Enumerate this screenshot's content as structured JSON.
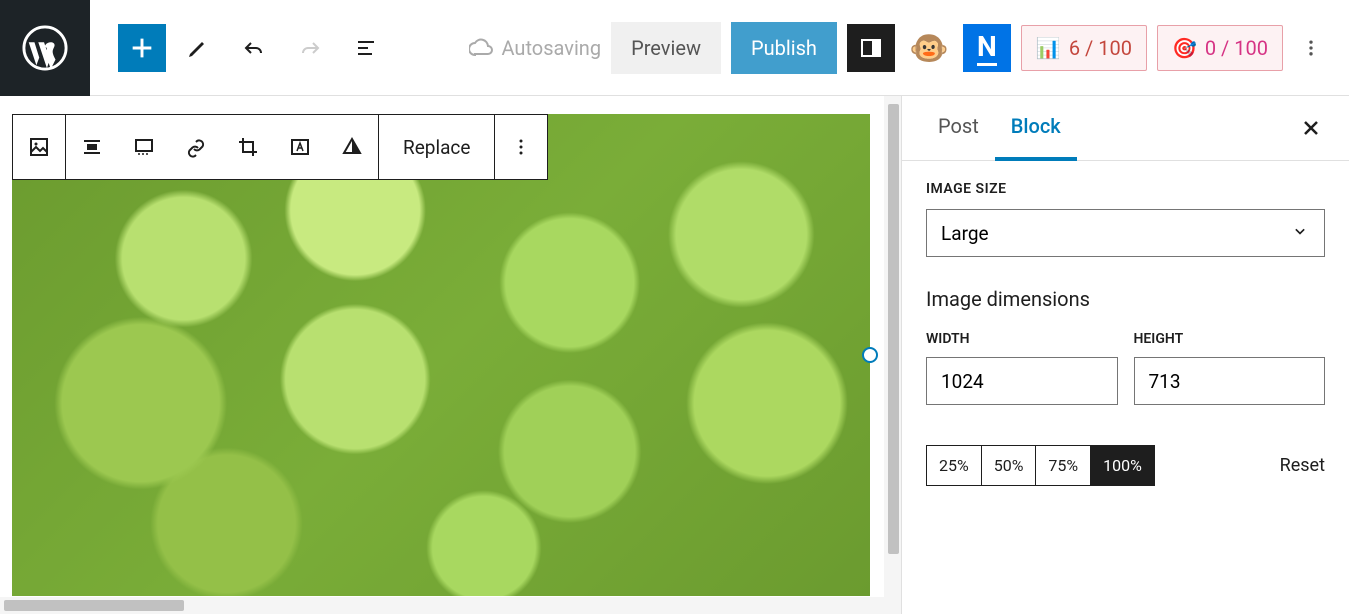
{
  "toolbar": {
    "autosaving": "Autosaving",
    "preview": "Preview",
    "publish": "Publish",
    "seo_score": "6 / 100",
    "readability": "0 / 100"
  },
  "block_toolbar": {
    "replace": "Replace"
  },
  "sidebar": {
    "tabs": {
      "post": "Post",
      "block": "Block"
    },
    "image_size_label": "IMAGE SIZE",
    "image_size_value": "Large",
    "dimensions_label": "Image dimensions",
    "width_label": "WIDTH",
    "width_value": "1024",
    "height_label": "HEIGHT",
    "height_value": "713",
    "pct": [
      "25%",
      "50%",
      "75%",
      "100%"
    ],
    "pct_active": "100%",
    "reset": "Reset"
  }
}
